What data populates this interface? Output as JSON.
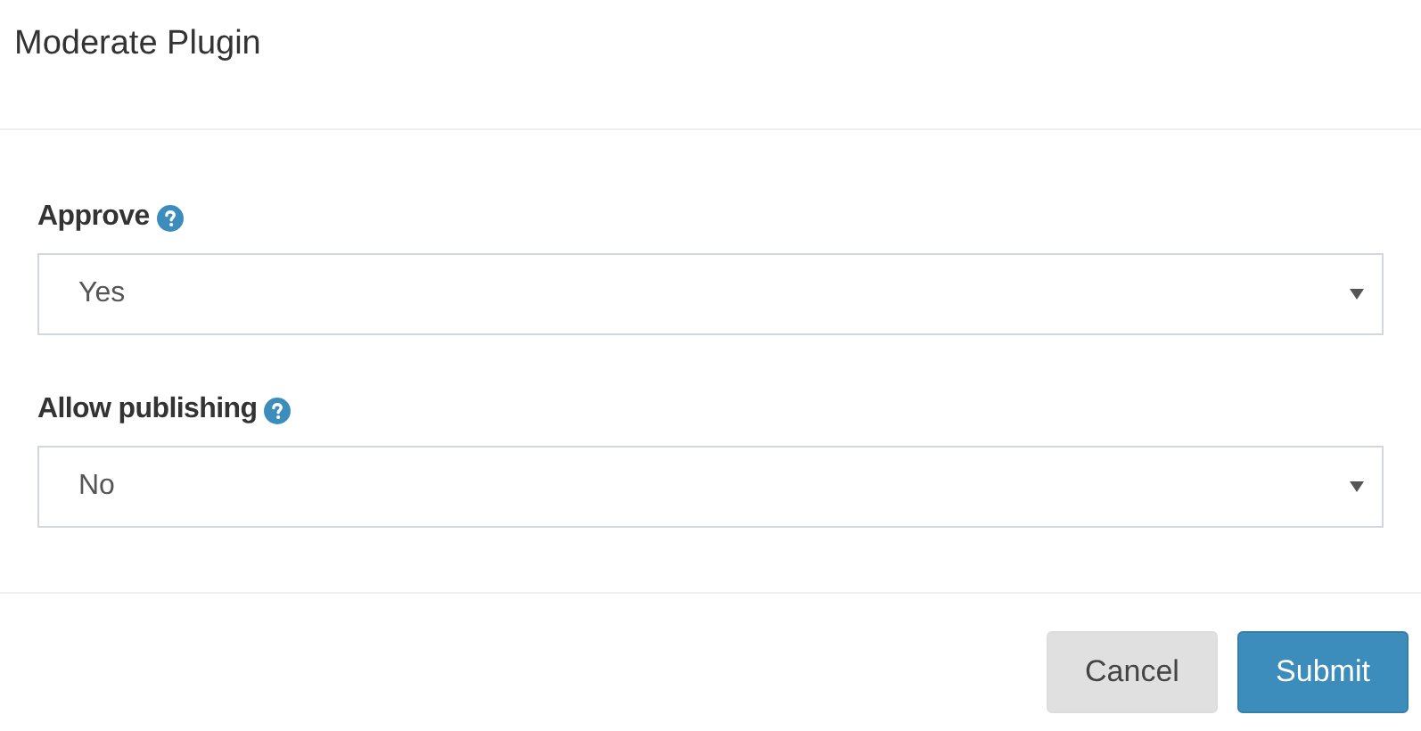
{
  "dialog": {
    "title": "Moderate Plugin"
  },
  "fields": [
    {
      "label": "Approve",
      "value": "Yes"
    },
    {
      "label": "Allow publishing",
      "value": "No"
    }
  ],
  "buttons": [
    {
      "label": "Cancel",
      "kind": "secondary"
    },
    {
      "label": "Submit",
      "kind": "primary"
    }
  ]
}
